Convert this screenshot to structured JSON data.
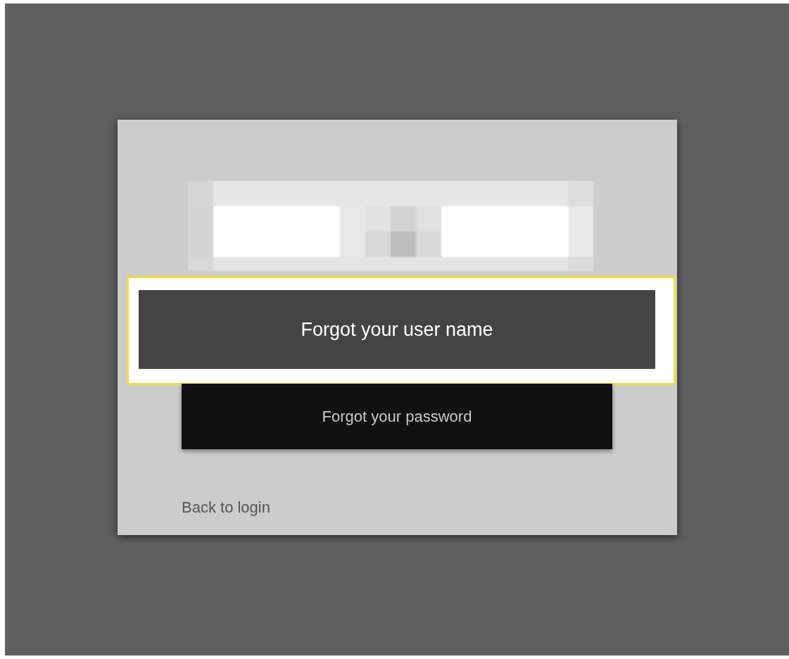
{
  "dialog": {
    "buttons": [
      {
        "label": "Forgot your user name",
        "selected": true
      },
      {
        "label": "Forgot your password",
        "selected": false
      }
    ],
    "link": "Back to login"
  }
}
